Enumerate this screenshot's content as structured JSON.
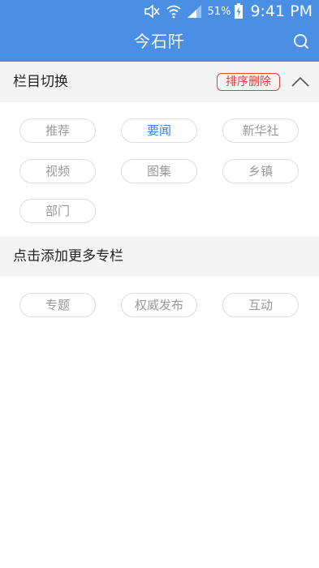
{
  "status_bar": {
    "battery_percent": "51%",
    "time": "9:41 PM",
    "icons": [
      "mute-icon",
      "wifi-icon",
      "signal-icon",
      "battery-charging-icon"
    ]
  },
  "header": {
    "title": "今石阡",
    "search_icon": "search-icon",
    "background_color": "#4a8fe3"
  },
  "channel_switch": {
    "title": "栏目切换",
    "sort_delete_label": "排序删除",
    "accent_color": "#d9423c",
    "collapse_icon": "chevron-up-icon",
    "channels": [
      {
        "label": "推荐",
        "active": false
      },
      {
        "label": "要闻",
        "active": true
      },
      {
        "label": "新华社",
        "active": false
      },
      {
        "label": "视频",
        "active": false
      },
      {
        "label": "图集",
        "active": false
      },
      {
        "label": "乡镇",
        "active": false
      },
      {
        "label": "部门",
        "active": false
      }
    ]
  },
  "add_more": {
    "title": "点击添加更多专栏",
    "channels": [
      {
        "label": "专题"
      },
      {
        "label": "权威发布"
      },
      {
        "label": "互动"
      }
    ]
  }
}
